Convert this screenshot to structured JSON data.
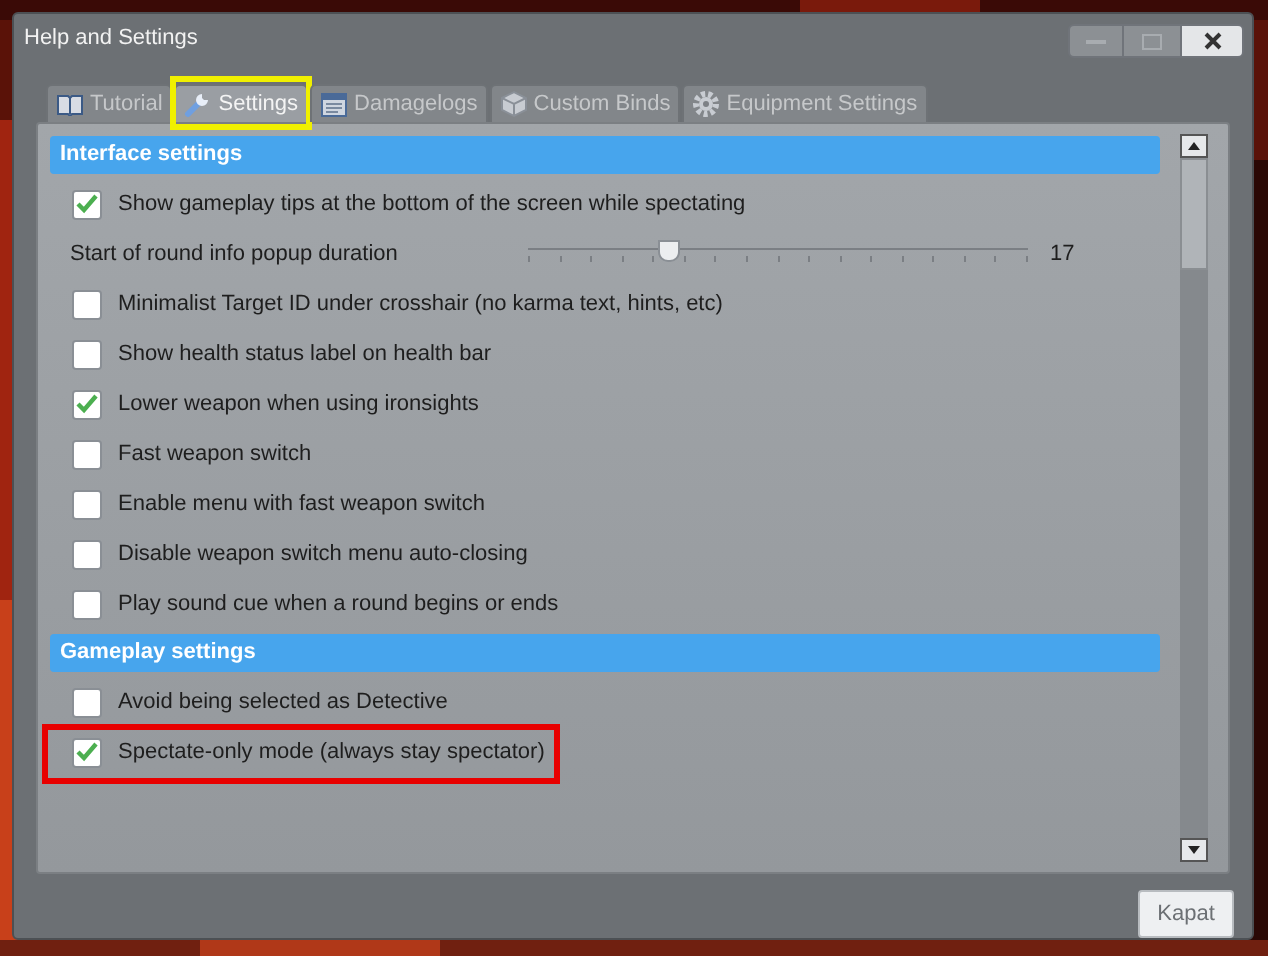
{
  "window": {
    "title": "Help and Settings"
  },
  "tabs": [
    {
      "label": "Tutorial",
      "selected": false
    },
    {
      "label": "Settings",
      "selected": true,
      "highlighted": true
    },
    {
      "label": "Damagelogs",
      "selected": false
    },
    {
      "label": "Custom Binds",
      "selected": false
    },
    {
      "label": "Equipment Settings",
      "selected": false
    }
  ],
  "sections": [
    {
      "title": "Interface settings",
      "items": [
        {
          "kind": "checkbox",
          "label": "Show gameplay tips at the bottom of the screen while spectating",
          "checked": true
        },
        {
          "kind": "slider",
          "label": "Start of round info popup duration",
          "level": 0.28,
          "reading": "17"
        },
        {
          "kind": "checkbox",
          "label": "Minimalist Target ID under crosshair (no karma text, hints, etc)",
          "checked": false
        },
        {
          "kind": "checkbox",
          "label": "Show health status label on health bar",
          "checked": false
        },
        {
          "kind": "checkbox",
          "label": "Lower weapon when using ironsights",
          "checked": true
        },
        {
          "kind": "checkbox",
          "label": "Fast weapon switch",
          "checked": false
        },
        {
          "kind": "checkbox",
          "label": "Enable menu with fast weapon switch",
          "checked": false
        },
        {
          "kind": "checkbox",
          "label": "Disable weapon switch menu auto-closing",
          "checked": false
        },
        {
          "kind": "checkbox",
          "label": "Play sound cue when a round begins or ends",
          "checked": false
        }
      ]
    },
    {
      "title": "Gameplay settings",
      "items": [
        {
          "kind": "checkbox",
          "label": "Avoid being selected as Detective",
          "checked": false
        },
        {
          "kind": "checkbox",
          "label": "Spectate-only mode (always stay spectator)",
          "checked": true,
          "highlighted": true
        }
      ]
    }
  ],
  "close_button": "Kapat"
}
